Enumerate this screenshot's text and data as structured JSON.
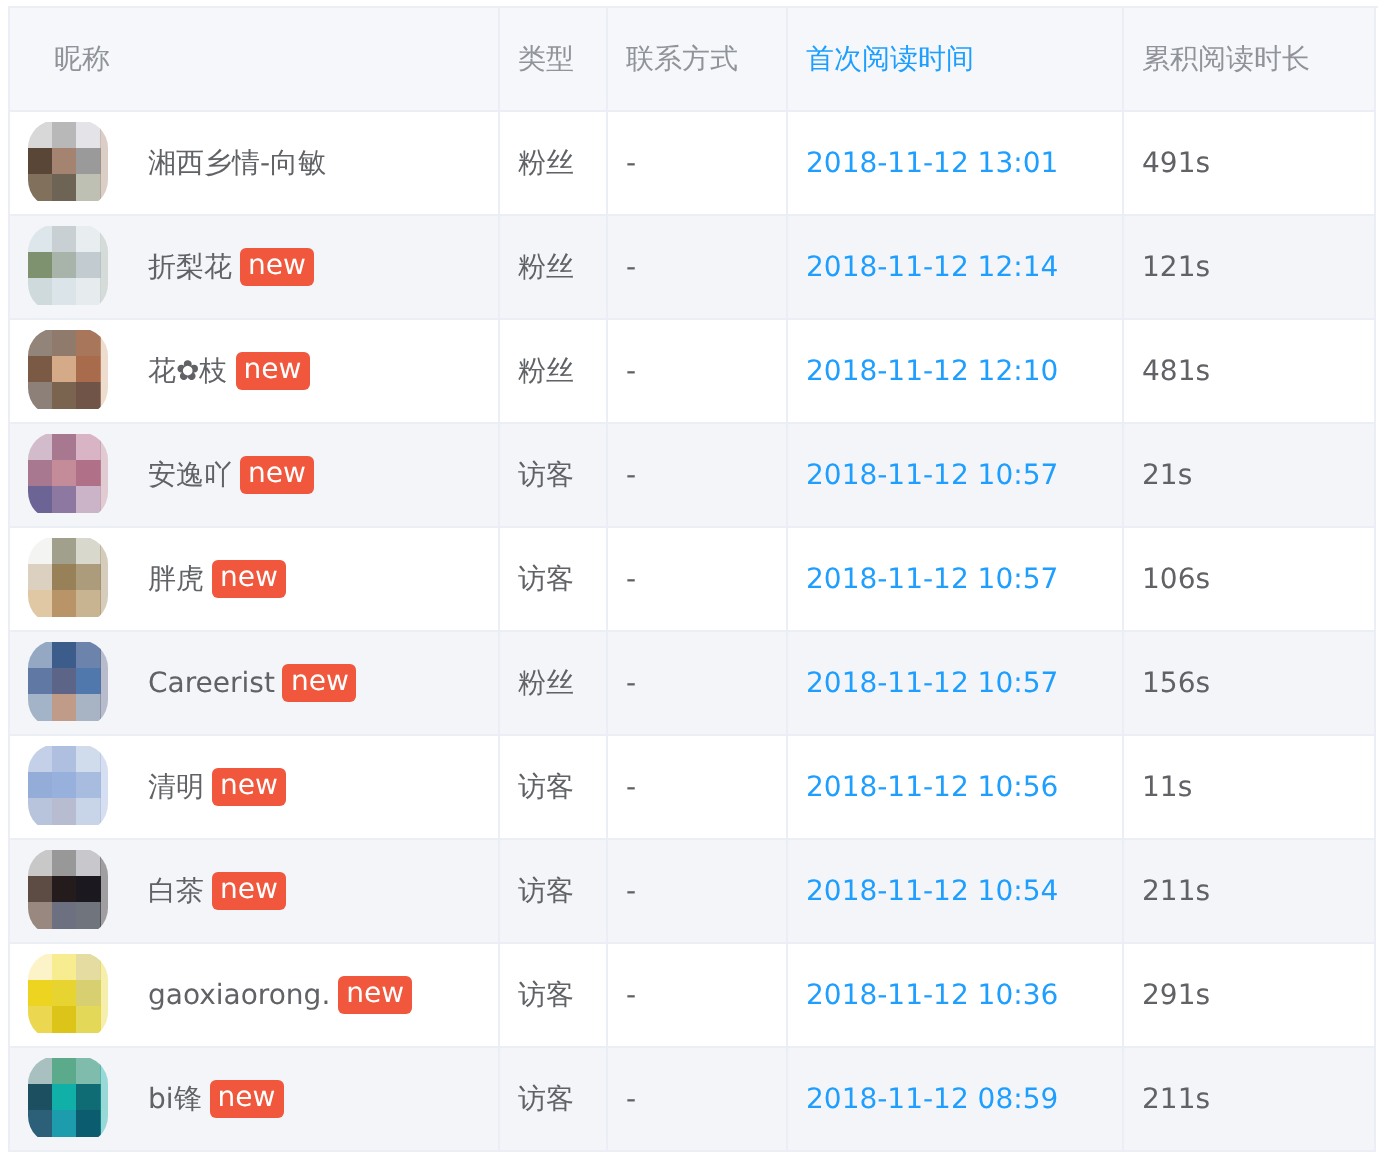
{
  "table": {
    "columns": [
      {
        "label": "昵称",
        "selected": false
      },
      {
        "label": "类型",
        "selected": false
      },
      {
        "label": "联系方式",
        "selected": false
      },
      {
        "label": "首次阅读时间",
        "selected": true
      },
      {
        "label": "累积阅读时长",
        "selected": false
      }
    ],
    "rows": [
      {
        "nickname": "湘西乡情-向敏",
        "type": "粉丝",
        "contact": "-",
        "first_read": "2018-11-12 13:01",
        "duration": "491s"
      },
      {
        "nickname": "折梨花",
        "badge": "new",
        "type": "粉丝",
        "contact": "-",
        "first_read": "2018-11-12 12:14",
        "duration": "121s"
      },
      {
        "nickname": "花✿枝",
        "badge": "new",
        "type": "粉丝",
        "contact": "-",
        "first_read": "2018-11-12 12:10",
        "duration": "481s"
      },
      {
        "nickname": "安逸吖",
        "badge": "new",
        "type": "访客",
        "contact": "-",
        "first_read": "2018-11-12 10:57",
        "duration": "21s"
      },
      {
        "nickname": "胖虎",
        "badge": "new",
        "type": "访客",
        "contact": "-",
        "first_read": "2018-11-12 10:57",
        "duration": "106s"
      },
      {
        "nickname": "Careerist",
        "badge": "new",
        "type": "粉丝",
        "contact": "-",
        "first_read": "2018-11-12 10:57",
        "duration": "156s"
      },
      {
        "nickname": "清明",
        "badge": "new",
        "type": "访客",
        "contact": "-",
        "first_read": "2018-11-12 10:56",
        "duration": "11s"
      },
      {
        "nickname": "白茶",
        "badge": "new",
        "type": "访客",
        "contact": "-",
        "first_read": "2018-11-12 10:54",
        "duration": "211s"
      },
      {
        "nickname": "gaoxiaorong.",
        "badge": "new",
        "type": "访客",
        "contact": "-",
        "first_read": "2018-11-12 10:36",
        "duration": "291s"
      },
      {
        "nickname": "bi锋",
        "badge": "new",
        "type": "访客",
        "contact": "-",
        "first_read": "2018-11-12 08:59",
        "duration": "211s"
      }
    ]
  }
}
